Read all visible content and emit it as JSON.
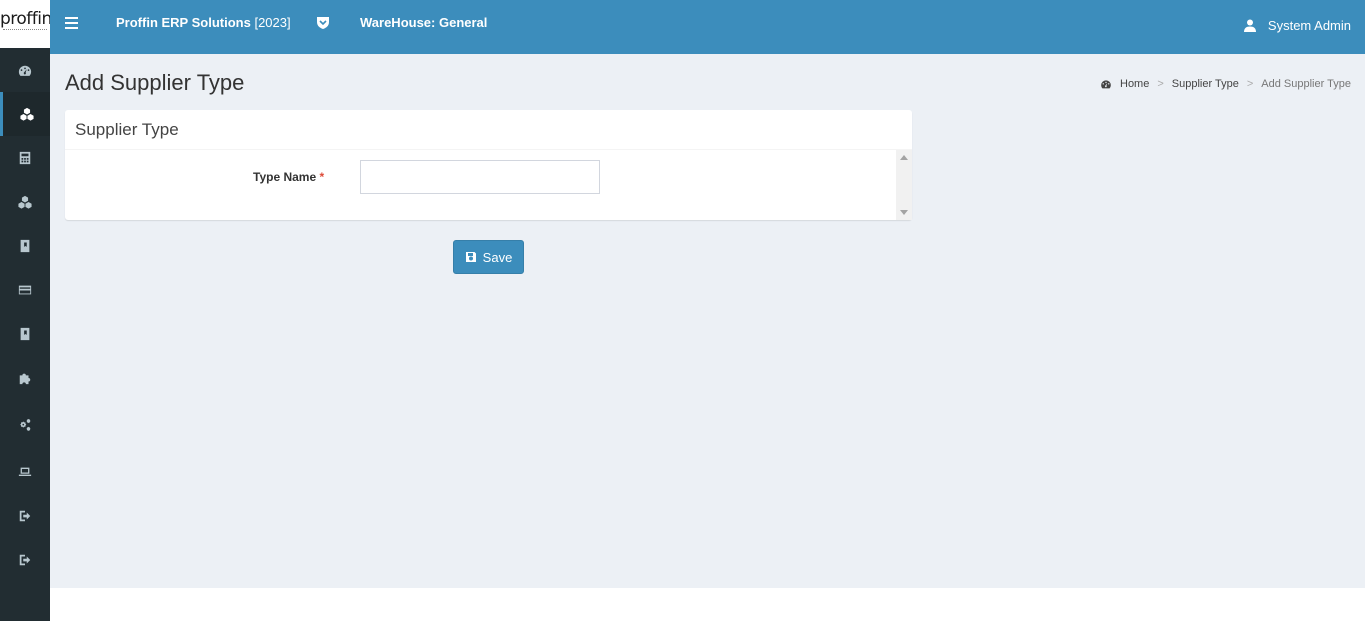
{
  "brand": {
    "logo_text": "proffin"
  },
  "header": {
    "app_name": "Proffin ERP Solutions",
    "app_year": "[2023]",
    "warehouse": "WareHouse: General",
    "user_name": "System Admin",
    "accent_color": "#3c8dbc"
  },
  "sidebar": {
    "items": [
      {
        "icon": "dashboard-icon"
      },
      {
        "icon": "cubes-icon",
        "active": true
      },
      {
        "icon": "calculator-icon"
      },
      {
        "icon": "cubes-icon"
      },
      {
        "icon": "book-icon"
      },
      {
        "icon": "credit-card-icon"
      },
      {
        "icon": "book-icon"
      },
      {
        "icon": "puzzle-icon"
      },
      {
        "icon": "gears-icon"
      },
      {
        "icon": "laptop-icon"
      },
      {
        "icon": "sign-out-icon"
      },
      {
        "icon": "sign-out-icon"
      }
    ]
  },
  "page": {
    "title": "Add Supplier Type",
    "breadcrumb": [
      "Home",
      "Supplier Type",
      "Add Supplier Type"
    ]
  },
  "form": {
    "box_title": "Supplier Type",
    "type_name_label": "Type Name",
    "required_mark": "*",
    "type_name_value": "",
    "save_label": "Save"
  }
}
